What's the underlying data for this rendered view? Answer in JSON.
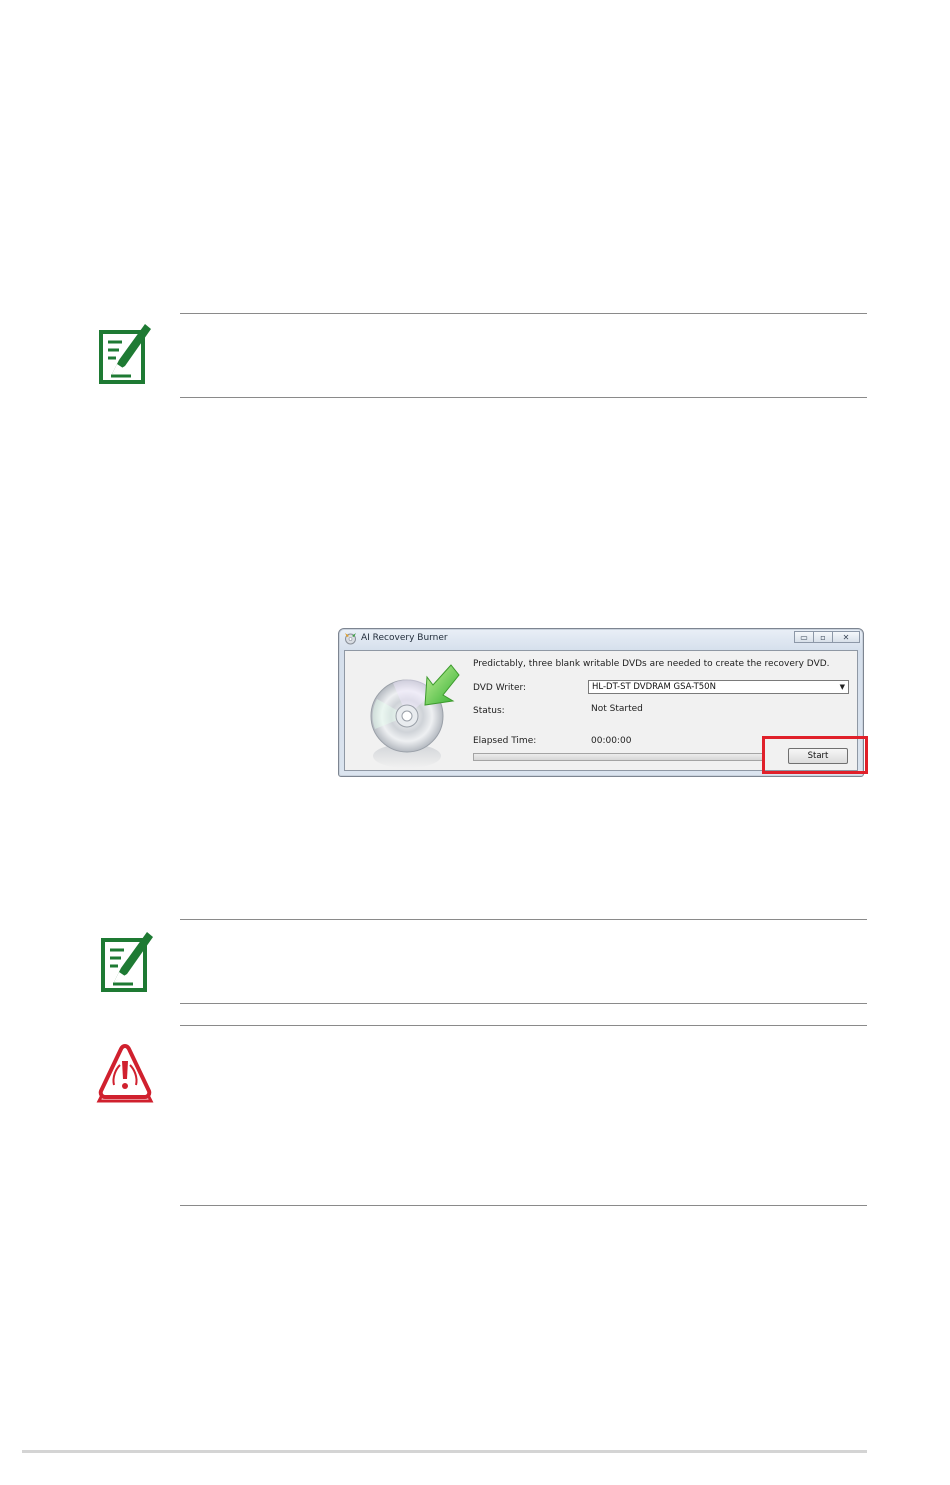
{
  "window": {
    "title": "AI Recovery Burner",
    "controls": {
      "minimize": "▭",
      "maximize": "▫",
      "close": "✕"
    },
    "info_text": "Predictably, three blank writable DVDs are needed to create the recovery DVD.",
    "dvd_writer_label": "DVD Writer:",
    "dvd_writer_value": "HL-DT-ST DVDRAM GSA-T50N",
    "status_label": "Status:",
    "status_value": "Not Started",
    "elapsed_label": "Elapsed Time:",
    "elapsed_value": "00:00:00",
    "progress": 0,
    "start_label": "Start"
  },
  "icons": {
    "note_1": "note-pencil-icon",
    "note_2": "note-pencil-icon",
    "warning": "warning-triangle-icon",
    "app": "disc-burner-icon",
    "disc": "dvd-disc-icon"
  },
  "colors": {
    "note_icon": "#1e7a33",
    "warning_icon": "#d0202e",
    "highlight_box": "#e0202a"
  }
}
